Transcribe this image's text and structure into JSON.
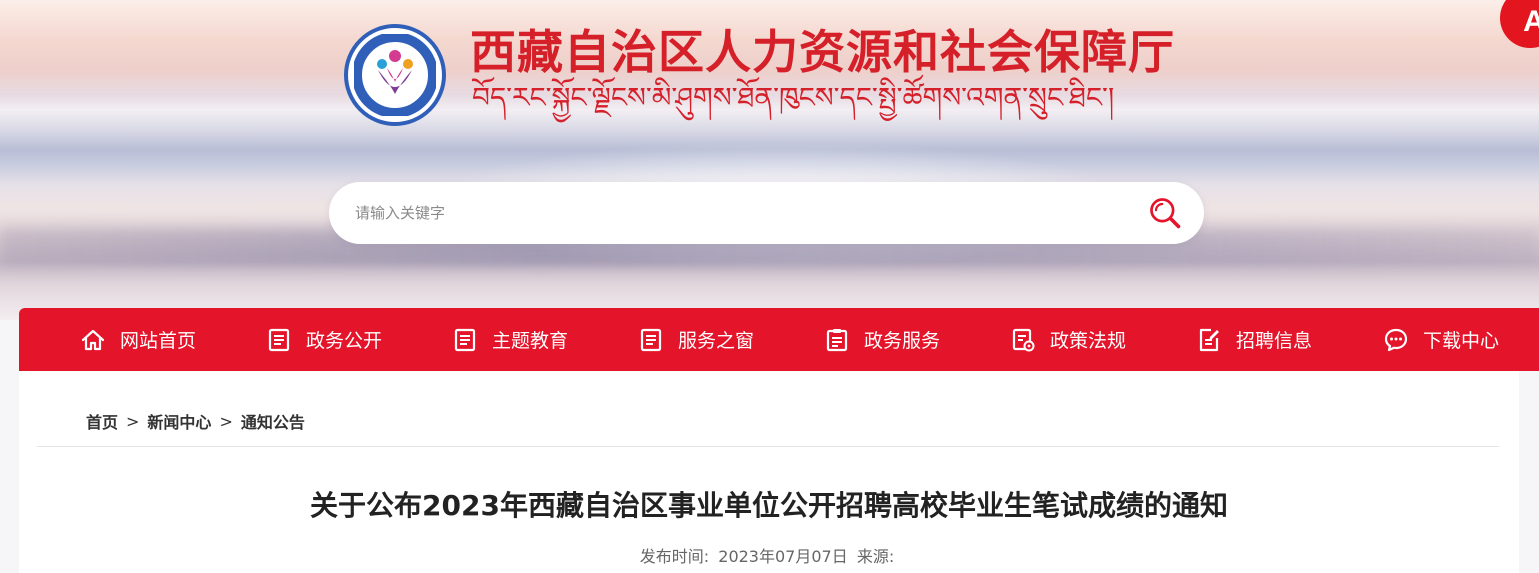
{
  "header": {
    "title": "西藏自治区人力资源和社会保障厅",
    "subtitle": "བོད་རང་སྐྱོང་ལྗོངས་མི་ཤུགས་ཐོན་ཁུངས་དང་སྤྱི་ཚོགས་འགན་སྲུང་ཐིང་།",
    "badge": "A",
    "colors": {
      "title": "#d5202a",
      "logo_ring": "#2f5fb8"
    }
  },
  "search": {
    "placeholder": "请输入关键字",
    "value": "",
    "icon": "search-icon"
  },
  "nav": {
    "color": "#e4142a",
    "items": [
      {
        "label": "网站首页",
        "icon": "home-icon"
      },
      {
        "label": "政务公开",
        "icon": "document-icon"
      },
      {
        "label": "主题教育",
        "icon": "document-icon"
      },
      {
        "label": "服务之窗",
        "icon": "document-icon"
      },
      {
        "label": "政务服务",
        "icon": "clipboard-icon"
      },
      {
        "label": "政策法规",
        "icon": "clipboard-gear-icon"
      },
      {
        "label": "招聘信息",
        "icon": "note-edit-icon"
      },
      {
        "label": "下载中心",
        "icon": "chat-icon"
      }
    ]
  },
  "breadcrumb": {
    "items": [
      "首页",
      "新闻中心",
      "通知公告"
    ],
    "separator": ">"
  },
  "article": {
    "title": "关于公布2023年西藏自治区事业单位公开招聘高校毕业生笔试成绩的通知",
    "publish_label": "发布时间:",
    "publish_date": "2023年07月07日",
    "source_label": "来源:",
    "source_value": ""
  }
}
